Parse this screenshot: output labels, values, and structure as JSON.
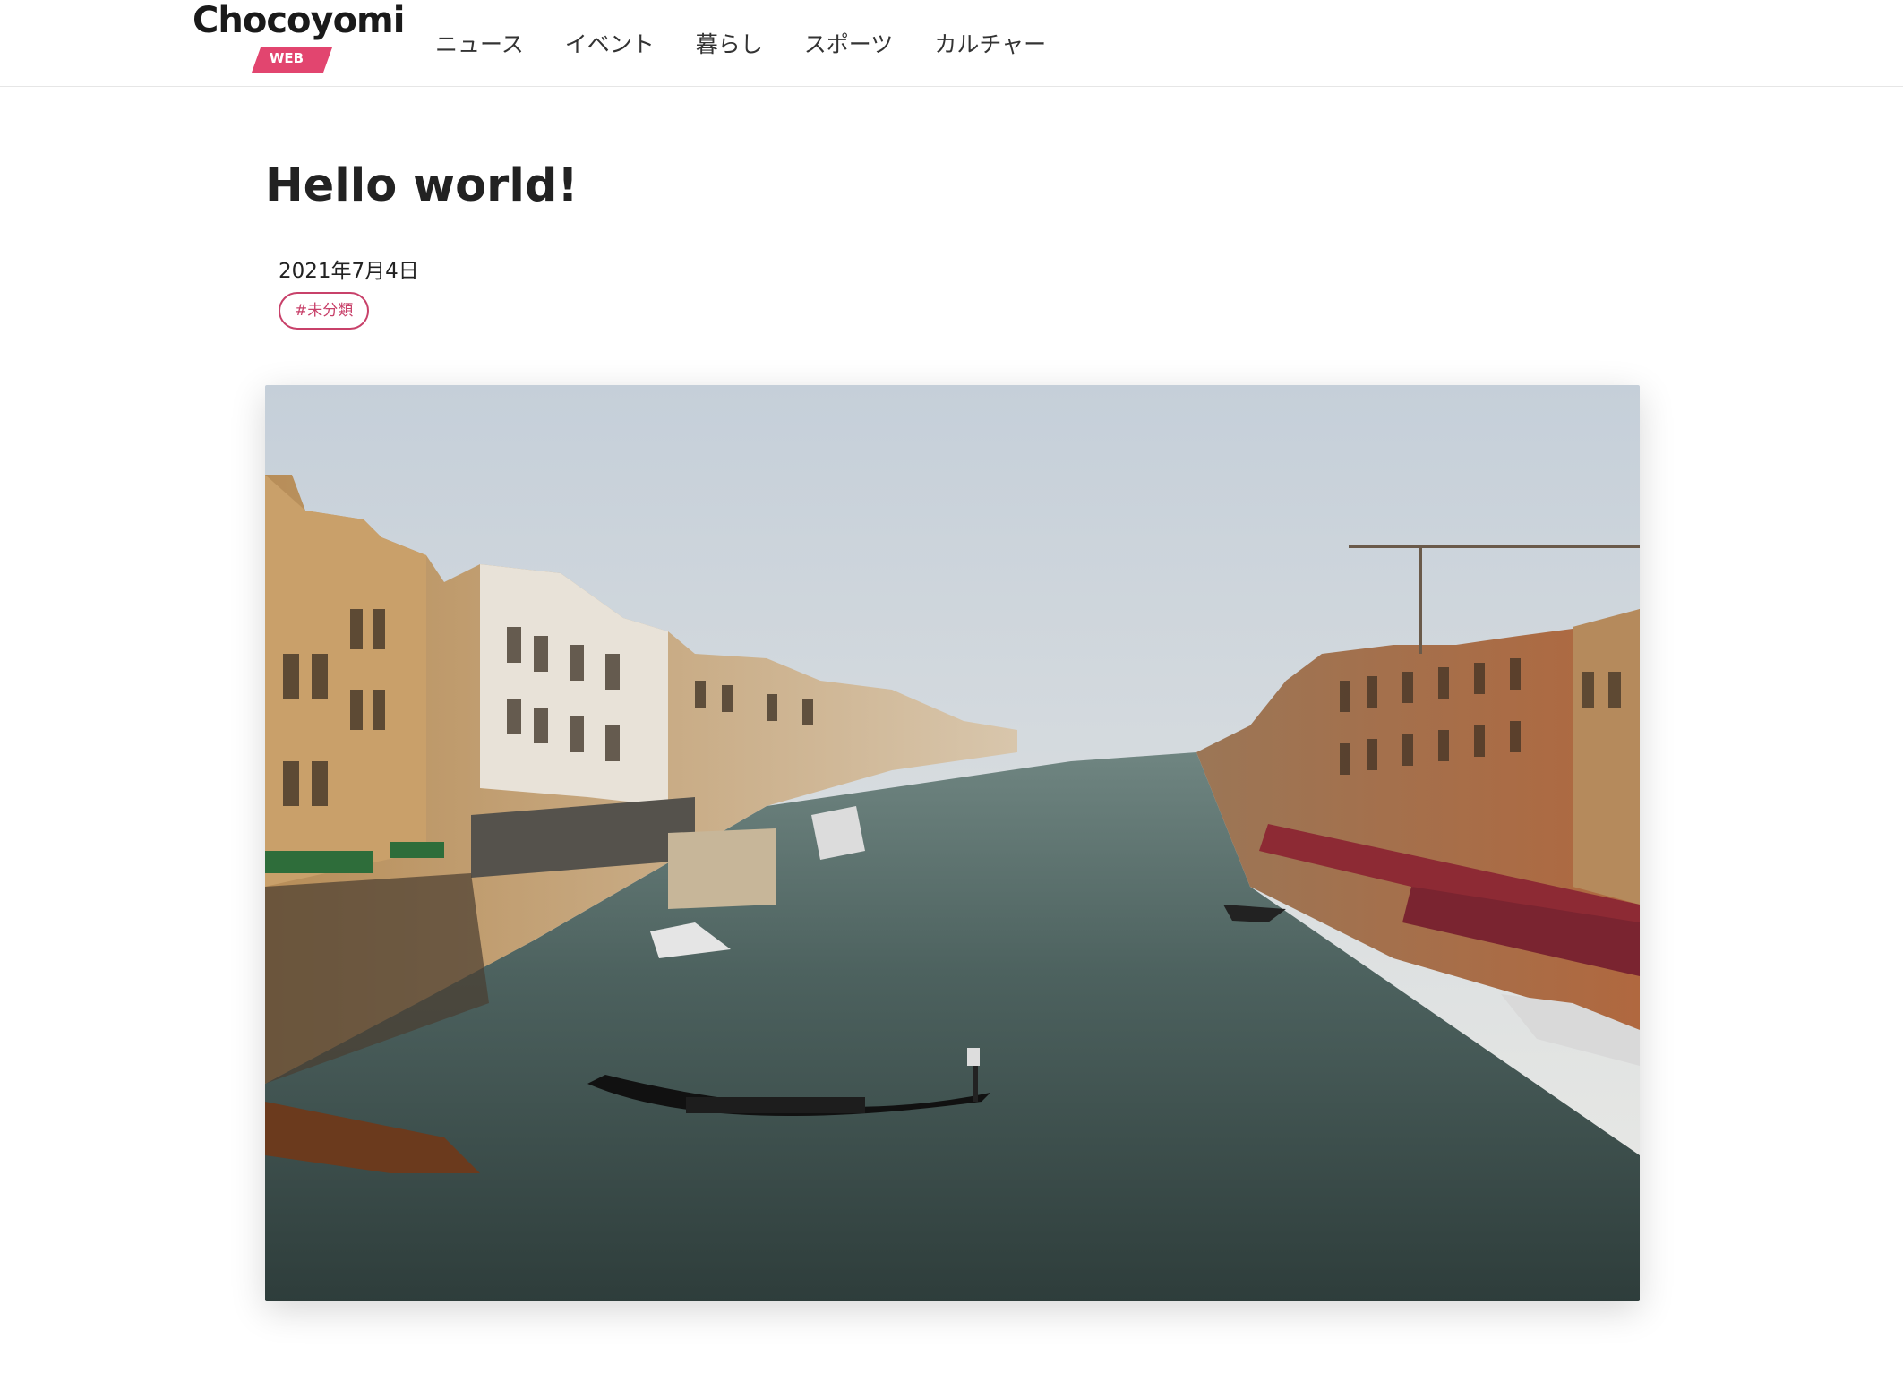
{
  "site": {
    "logo_text": "Chocoyomi",
    "logo_badge": "WEB",
    "brand_color": "#e2456f"
  },
  "nav": {
    "items": [
      "ニュース",
      "イベント",
      "暮らし",
      "スポーツ",
      "カルチャー"
    ]
  },
  "post": {
    "title": "Hello world!",
    "date": "2021年7月4日",
    "category_tag": "#未分類",
    "tag_color": "#c8416a",
    "featured_image_icon": "venice-canal-photo"
  }
}
